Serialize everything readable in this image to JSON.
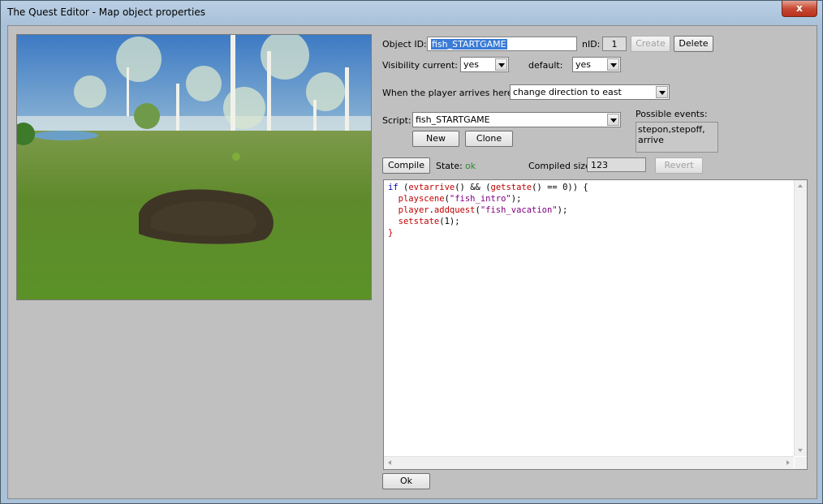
{
  "window": {
    "title": "The Quest Editor - Map object properties",
    "close_glyph": "x"
  },
  "object": {
    "id_label": "Object ID:",
    "id_value": "fish_STARTGAME",
    "nid_label": "nID:",
    "nid_value": "1",
    "create_label": "Create",
    "delete_label": "Delete"
  },
  "visibility": {
    "current_label": "Visibility current:",
    "current_value": "yes",
    "default_label": "default:",
    "default_value": "yes"
  },
  "arrival": {
    "label": "When the player arrives here...",
    "value": "change direction to east"
  },
  "script": {
    "label": "Script:",
    "value": "fish_STARTGAME",
    "new_label": "New",
    "clone_label": "Clone",
    "events_label": "Possible events:",
    "events_text": "stepon,stepoff, arrive"
  },
  "compile": {
    "button_label": "Compile",
    "state_label": "State:",
    "state_value": "ok",
    "size_label": "Compiled size:",
    "size_value": "123",
    "revert_label": "Revert"
  },
  "code_lines": [
    "if (evtarrive() && (getstate() == 0)) {",
    "  playscene(\"fish_intro\");",
    "  player.addquest(\"fish_vacation\");",
    "  setstate(1);",
    "}"
  ],
  "ok_label": "Ok",
  "colors": {
    "state_ok": "#2e8b2e",
    "keyword": "#0000c0",
    "func": "#c00000",
    "string": "#800080",
    "selection": "#3a7bd5"
  }
}
